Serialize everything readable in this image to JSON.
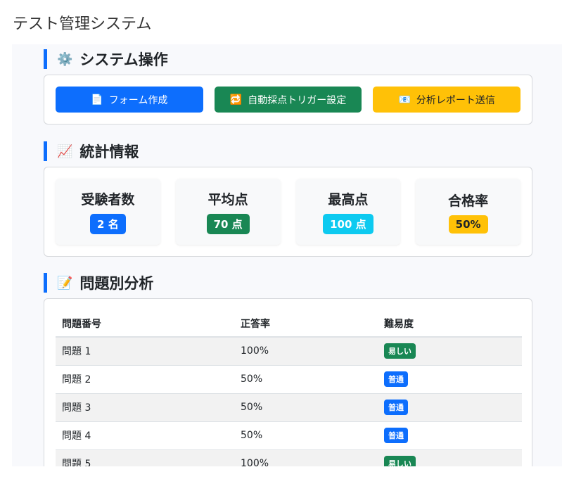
{
  "window": {
    "title": "テスト管理システム"
  },
  "operations": {
    "title": "システム操作",
    "icon": "gear-icon",
    "buttons": [
      {
        "label": "フォーム作成",
        "icon": "document-icon",
        "color": "#0d6efd"
      },
      {
        "label": "自動採点トリガー設定",
        "icon": "repeat-icon",
        "color": "#198754"
      },
      {
        "label": "分析レポート送信",
        "icon": "email-icon",
        "color": "#ffc107"
      }
    ]
  },
  "stats": {
    "title": "統計情報",
    "icon": "chart-icon",
    "items": [
      {
        "label": "受験者数",
        "value": "2 名",
        "color": "#0d6efd"
      },
      {
        "label": "平均点",
        "value": "70 点",
        "color": "#198754"
      },
      {
        "label": "最高点",
        "value": "100 点",
        "color": "#0dcaf0"
      },
      {
        "label": "合格率",
        "value": "50%",
        "color": "#ffc107"
      }
    ]
  },
  "analysis": {
    "title": "問題別分析",
    "icon": "memo-icon",
    "headers": [
      "問題番号",
      "正答率",
      "難易度"
    ],
    "rows": [
      {
        "q": "問題 1",
        "rate": "100%",
        "level": "易しい",
        "color": "#198754"
      },
      {
        "q": "問題 2",
        "rate": "50%",
        "level": "普通",
        "color": "#0d6efd"
      },
      {
        "q": "問題 3",
        "rate": "50%",
        "level": "普通",
        "color": "#0d6efd"
      },
      {
        "q": "問題 4",
        "rate": "50%",
        "level": "普通",
        "color": "#0d6efd"
      },
      {
        "q": "問題 5",
        "rate": "100%",
        "level": "易しい",
        "color": "#198754"
      }
    ]
  }
}
